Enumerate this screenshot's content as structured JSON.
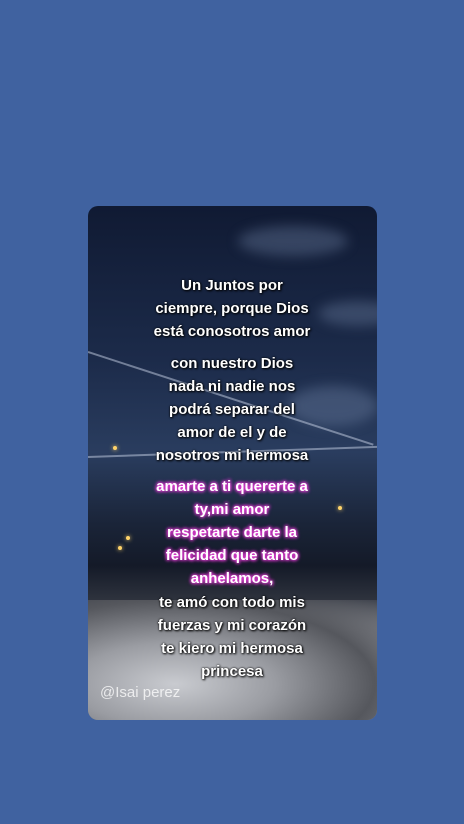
{
  "post": {
    "line_1": "Un Juntos por\nciempre, porque Dios\nestá conosotros amor",
    "line_2": "con nuestro Dios\nnada ni nadie nos\npodrá separar del\namor de el y de\nnosotros mi hermosa",
    "line_3": "amarte a ti quererte  a\nty,mi amor\nrespetarte darte la\nfelicidad que tanto\nanhelamos,",
    "line_4": "te amó con todo mis\nfuerzas y mi corazón\nte kiero mi hermosa\nprincesa"
  },
  "watermark": "@Isai perez",
  "colors": {
    "background": "#4062a0",
    "highlight_glow": "#e53ad6",
    "text": "#ffffff"
  }
}
